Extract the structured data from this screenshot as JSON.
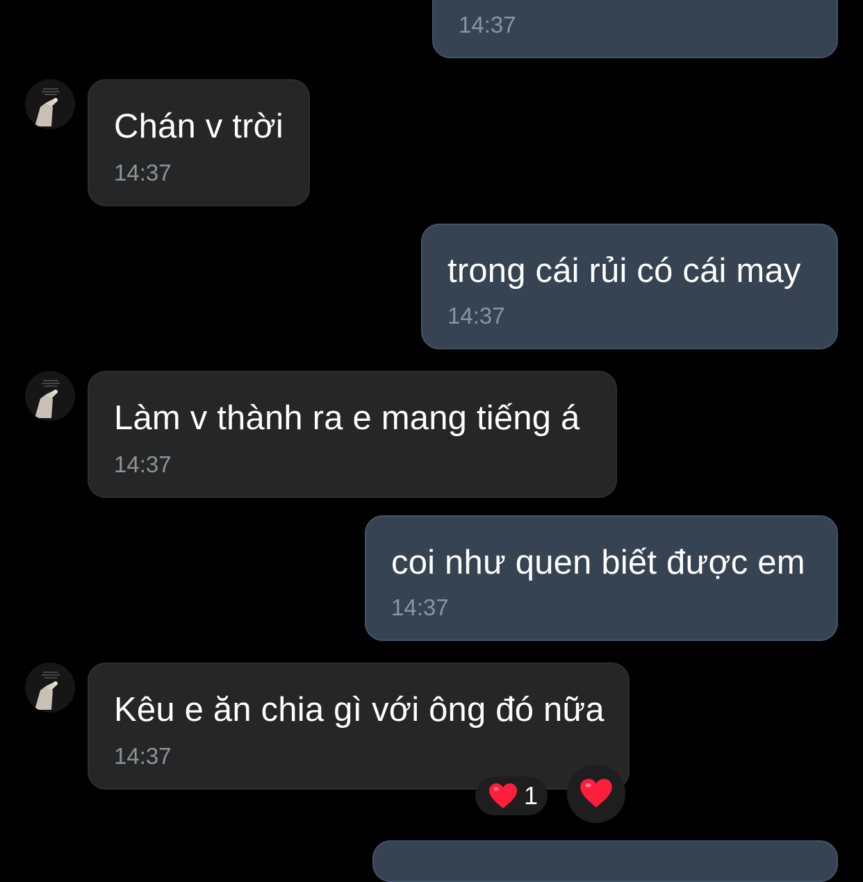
{
  "chat": {
    "messages": [
      {
        "direction": "outgoing",
        "text": "",
        "time": "14:37"
      },
      {
        "direction": "incoming",
        "text": "Chán v trời",
        "time": "14:37"
      },
      {
        "direction": "outgoing",
        "text": "trong cái rủi có cái may",
        "time": "14:37"
      },
      {
        "direction": "incoming",
        "text": "Làm v thành ra e mang tiếng á",
        "time": "14:37"
      },
      {
        "direction": "outgoing",
        "text": "coi như quen biết được em",
        "time": "14:37"
      },
      {
        "direction": "incoming",
        "text": "Kêu e ăn chia gì với ông đó nữa",
        "time": "14:37"
      }
    ],
    "reaction": {
      "icon": "heart-icon",
      "count": "1"
    }
  },
  "colors": {
    "background": "#000000",
    "incoming_bubble": "#262626",
    "outgoing_bubble": "#364352",
    "heart": "#ff1f3d"
  }
}
